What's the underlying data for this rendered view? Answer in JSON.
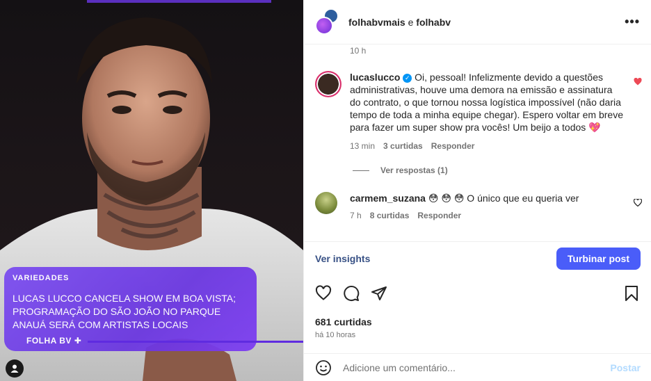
{
  "header": {
    "account1": "folhabvmais",
    "connector": " e ",
    "account2": "folhabv",
    "more_icon": "more-horizontal-icon"
  },
  "post_time_top": "10 h",
  "comments": [
    {
      "user": "lucaslucco",
      "verified": true,
      "text": "Oi, pessoal! Infelizmente devido a questões administrativas, houve uma demora na emissão e assinatura do contrato, o que tornou nossa logística impossível (não daria tempo de toda a minha equipe chegar). Espero voltar em breve para fazer um super show pra vocês! Um beijo a todos 💖",
      "time": "13 min",
      "likes": "3 curtidas",
      "reply": "Responder",
      "liked": true,
      "view_replies": "Ver respostas (1)"
    },
    {
      "user": "carmem_suzana",
      "verified": false,
      "text": "😳 😳 😳  O único que eu queria ver",
      "time": "7 h",
      "likes": "8 curtidas",
      "reply": "Responder",
      "liked": false
    }
  ],
  "actions": {
    "insights": "Ver insights",
    "boost": "Turbinar post"
  },
  "stats": {
    "likes": "681 curtidas",
    "ago": "há 10 horas"
  },
  "add_comment": {
    "placeholder": "Adicione um comentário...",
    "post": "Postar"
  },
  "news_card": {
    "category": "VARIEDADES",
    "title": "LUCAS LUCCO CANCELA SHOW EM BOA VISTA; PROGRAMAÇÃO DO SÃO JOÃO NO PARQUE ANAUÁ SERÁ COM ARTISTAS LOCAIS",
    "brand": "FOLHA BV ✚"
  },
  "colors": {
    "accent": "#4a5df9",
    "card": "#7b4df0",
    "heart": "#ed4956"
  }
}
